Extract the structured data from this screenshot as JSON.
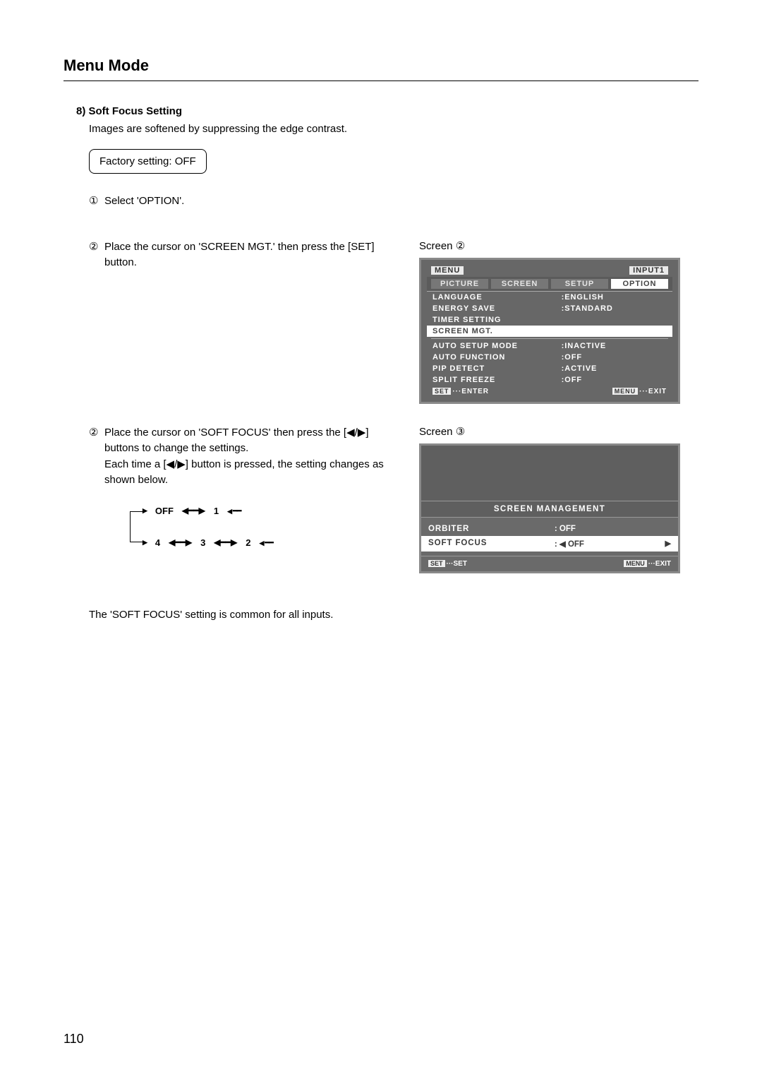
{
  "page": {
    "title": "Menu Mode",
    "number": "110"
  },
  "section": {
    "heading": "8) Soft Focus Setting",
    "intro": "Images are softened by suppressing the edge contrast.",
    "factory_box": "Factory setting: OFF"
  },
  "steps": {
    "s1_num": "①",
    "s1_txt": "Select 'OPTION'.",
    "s2_num": "②",
    "s2_txt": "Place the cursor on 'SCREEN MGT.' then press the [SET] button.",
    "s3_num": "②",
    "s3_txt_a": "Place the cursor on 'SOFT FOCUS' then press the [◀/▶] buttons to change the settings.",
    "s3_txt_b": "Each time a [◀/▶] button is pressed, the setting changes as shown below."
  },
  "cycle": {
    "off": "OFF",
    "v1": "1",
    "v2": "2",
    "v3": "3",
    "v4": "4"
  },
  "note": "The 'SOFT FOCUS' setting is common for all inputs.",
  "screen2": {
    "label": "Screen ②",
    "top_left": "MENU",
    "top_right": "INPUT1",
    "tabs": {
      "picture": "PICTURE",
      "screen": "SCREEN",
      "setup": "SETUP",
      "option": "OPTION"
    },
    "rows": [
      {
        "k": "LANGUAGE",
        "v": ":ENGLISH"
      },
      {
        "k": "ENERGY SAVE",
        "v": ":STANDARD"
      },
      {
        "k": "TIMER SETTING",
        "v": ""
      },
      {
        "k": "SCREEN MGT.",
        "v": "",
        "hl": true
      },
      {
        "k": "AUTO SETUP MODE",
        "v": ":INACTIVE"
      },
      {
        "k": "AUTO FUNCTION",
        "v": ":OFF"
      },
      {
        "k": "PIP DETECT",
        "v": ":ACTIVE"
      },
      {
        "k": "SPLIT FREEZE",
        "v": ":OFF"
      }
    ],
    "footer_left_chip": "SET",
    "footer_left": "···ENTER",
    "footer_right_chip": "MENU",
    "footer_right": "···EXIT"
  },
  "screen3": {
    "label": "Screen ③",
    "title": "SCREEN MANAGEMENT",
    "row1_k": "ORBITER",
    "row1_v": ":   OFF",
    "row2_k": "SOFT FOCUS",
    "row2_v": ": ◀ OFF",
    "footer_left_chip": "SET",
    "footer_left": "···SET",
    "footer_right_chip": "MENU",
    "footer_right": "···EXIT"
  }
}
